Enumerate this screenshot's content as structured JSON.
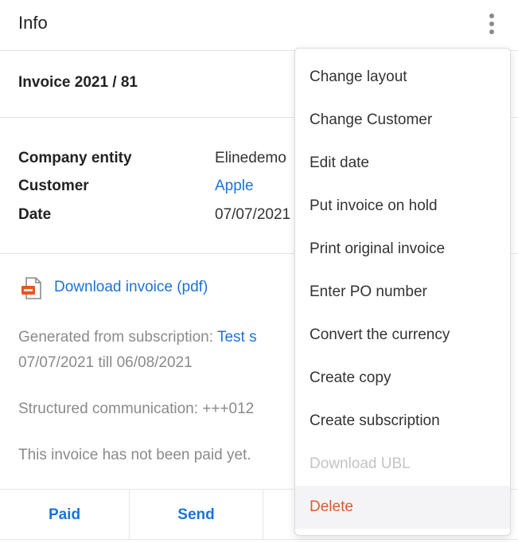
{
  "header": {
    "title": "Info",
    "more_icon": "vertical-ellipsis-icon"
  },
  "invoice": {
    "title": "Invoice 2021 / 81"
  },
  "details": {
    "company_entity_label": "Company entity",
    "company_entity_value": "Elinedemo",
    "customer_label": "Customer",
    "customer_value": "Apple",
    "date_label": "Date",
    "date_value": "07/07/2021"
  },
  "download": {
    "icon": "pdf-file-icon",
    "label": "Download invoice (pdf)"
  },
  "info": {
    "generated_prefix": "Generated from subscription:",
    "generated_link": "Test s",
    "period": "07/07/2021 till 06/08/2021",
    "structured_communication": "Structured communication: +++012",
    "payment_status": "This invoice has not been paid yet."
  },
  "actions": {
    "paid": "Paid",
    "send": "Send"
  },
  "menu": {
    "items": [
      {
        "label": "Change layout"
      },
      {
        "label": "Change Customer"
      },
      {
        "label": "Edit date"
      },
      {
        "label": "Put invoice on hold"
      },
      {
        "label": "Print original invoice"
      },
      {
        "label": "Enter PO number"
      },
      {
        "label": "Convert the currency"
      },
      {
        "label": "Create copy"
      },
      {
        "label": "Create subscription"
      },
      {
        "label": "Download UBL",
        "disabled": true
      },
      {
        "label": "Delete",
        "danger": true
      }
    ]
  },
  "colors": {
    "link": "#1a73d9",
    "danger": "#e05a2b",
    "muted": "#8a8a8a",
    "disabled": "#c4c4c4"
  }
}
